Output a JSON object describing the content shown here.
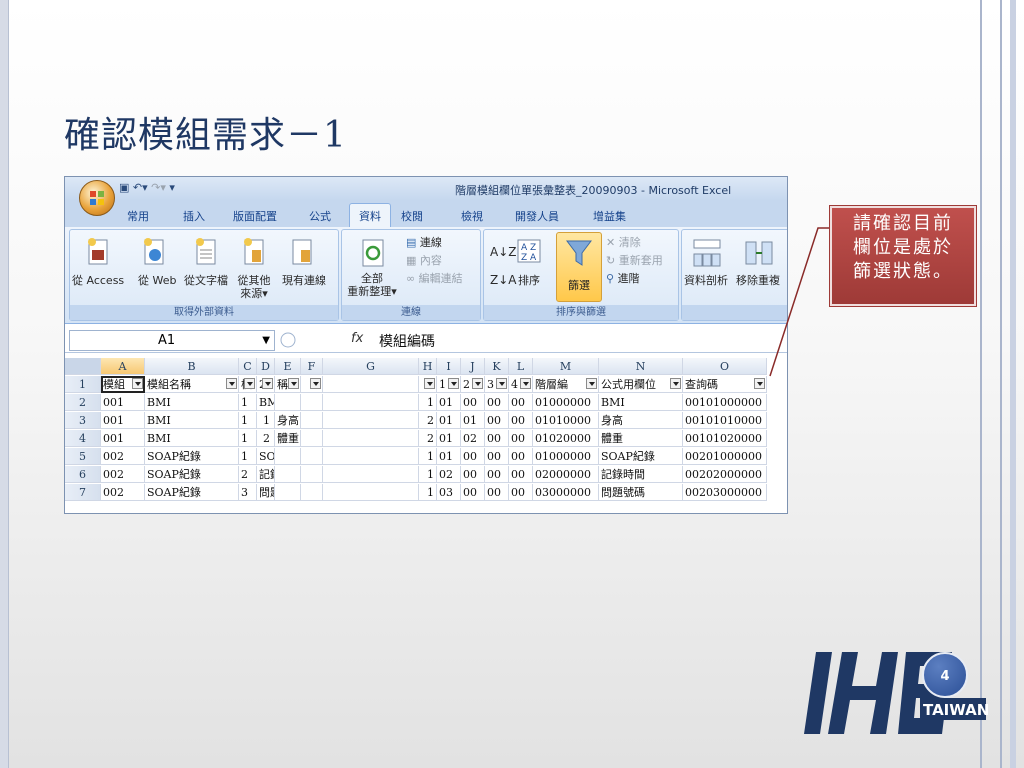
{
  "slide": {
    "title": "確認模組需求－1",
    "page_number": "4",
    "callout": [
      "請確認目前",
      "欄位是處於",
      "篩選狀態。"
    ],
    "logo": {
      "text": "IHE",
      "subtext": "TAIWAN"
    }
  },
  "excel": {
    "window_title": "階層模組欄位單張彙整表_20090903 - Microsoft Excel",
    "tabs": [
      "常用",
      "插入",
      "版面配置",
      "公式",
      "資料",
      "校閱",
      "檢視",
      "開發人員",
      "增益集"
    ],
    "active_tab": "資料",
    "ribbon": {
      "groups": [
        {
          "label": "取得外部資料",
          "buttons": [
            "從 Access",
            "從 Web",
            "從文字檔",
            "從其他\n來源▾",
            "現有連線"
          ]
        },
        {
          "label": "連線",
          "buttons": [
            "全部\n重新整理▾",
            "連線",
            "內容",
            "編輯連結"
          ]
        },
        {
          "label": "排序與篩選",
          "buttons": [
            "排序",
            "篩選",
            "清除",
            "重新套用",
            "進階"
          ]
        },
        {
          "label": "",
          "buttons": [
            "資料剖析",
            "移除重複"
          ]
        }
      ]
    },
    "name_box": "A1",
    "formula_value": "模組編碼",
    "columns": [
      "A",
      "B",
      "C",
      "D",
      "E",
      "F",
      "G",
      "H",
      "I",
      "J",
      "K",
      "L",
      "M",
      "N",
      "O"
    ],
    "header_row": [
      "模組",
      "模組名稱",
      "模",
      "2",
      "稱",
      "",
      "",
      "",
      "1",
      "2",
      "3",
      "4",
      "階層編",
      "公式用欄位",
      "查詢碼"
    ],
    "rows": [
      {
        "n": "2",
        "cells": [
          "001",
          "BMI",
          "1",
          "BMI",
          "",
          "",
          "",
          "1",
          "01",
          "00",
          "00",
          "00",
          "01000000",
          "BMI",
          "00101000000"
        ]
      },
      {
        "n": "3",
        "cells": [
          "001",
          "BMI",
          "1",
          "1",
          "身高",
          "",
          "",
          "2",
          "01",
          "01",
          "00",
          "00",
          "01010000",
          "身高",
          "00101010000"
        ]
      },
      {
        "n": "4",
        "cells": [
          "001",
          "BMI",
          "1",
          "2",
          "體重",
          "",
          "",
          "2",
          "01",
          "02",
          "00",
          "00",
          "01020000",
          "體重",
          "00101020000"
        ]
      },
      {
        "n": "5",
        "cells": [
          "002",
          "SOAP紀錄",
          "1",
          "SOAP紀錄",
          "",
          "",
          "",
          "1",
          "01",
          "00",
          "00",
          "00",
          "01000000",
          "SOAP紀錄",
          "00201000000"
        ]
      },
      {
        "n": "6",
        "cells": [
          "002",
          "SOAP紀錄",
          "2",
          "記錄時間",
          "",
          "",
          "",
          "1",
          "02",
          "00",
          "00",
          "00",
          "02000000",
          "記錄時間",
          "00202000000"
        ]
      },
      {
        "n": "7",
        "cells": [
          "002",
          "SOAP紀錄",
          "3",
          "問題號碼",
          "",
          "",
          "",
          "1",
          "03",
          "00",
          "00",
          "00",
          "03000000",
          "問題號碼",
          "00203000000"
        ]
      }
    ]
  },
  "colors": {
    "title": "#1f3864",
    "callout": "#c0504d",
    "logo": "#1f3864"
  }
}
